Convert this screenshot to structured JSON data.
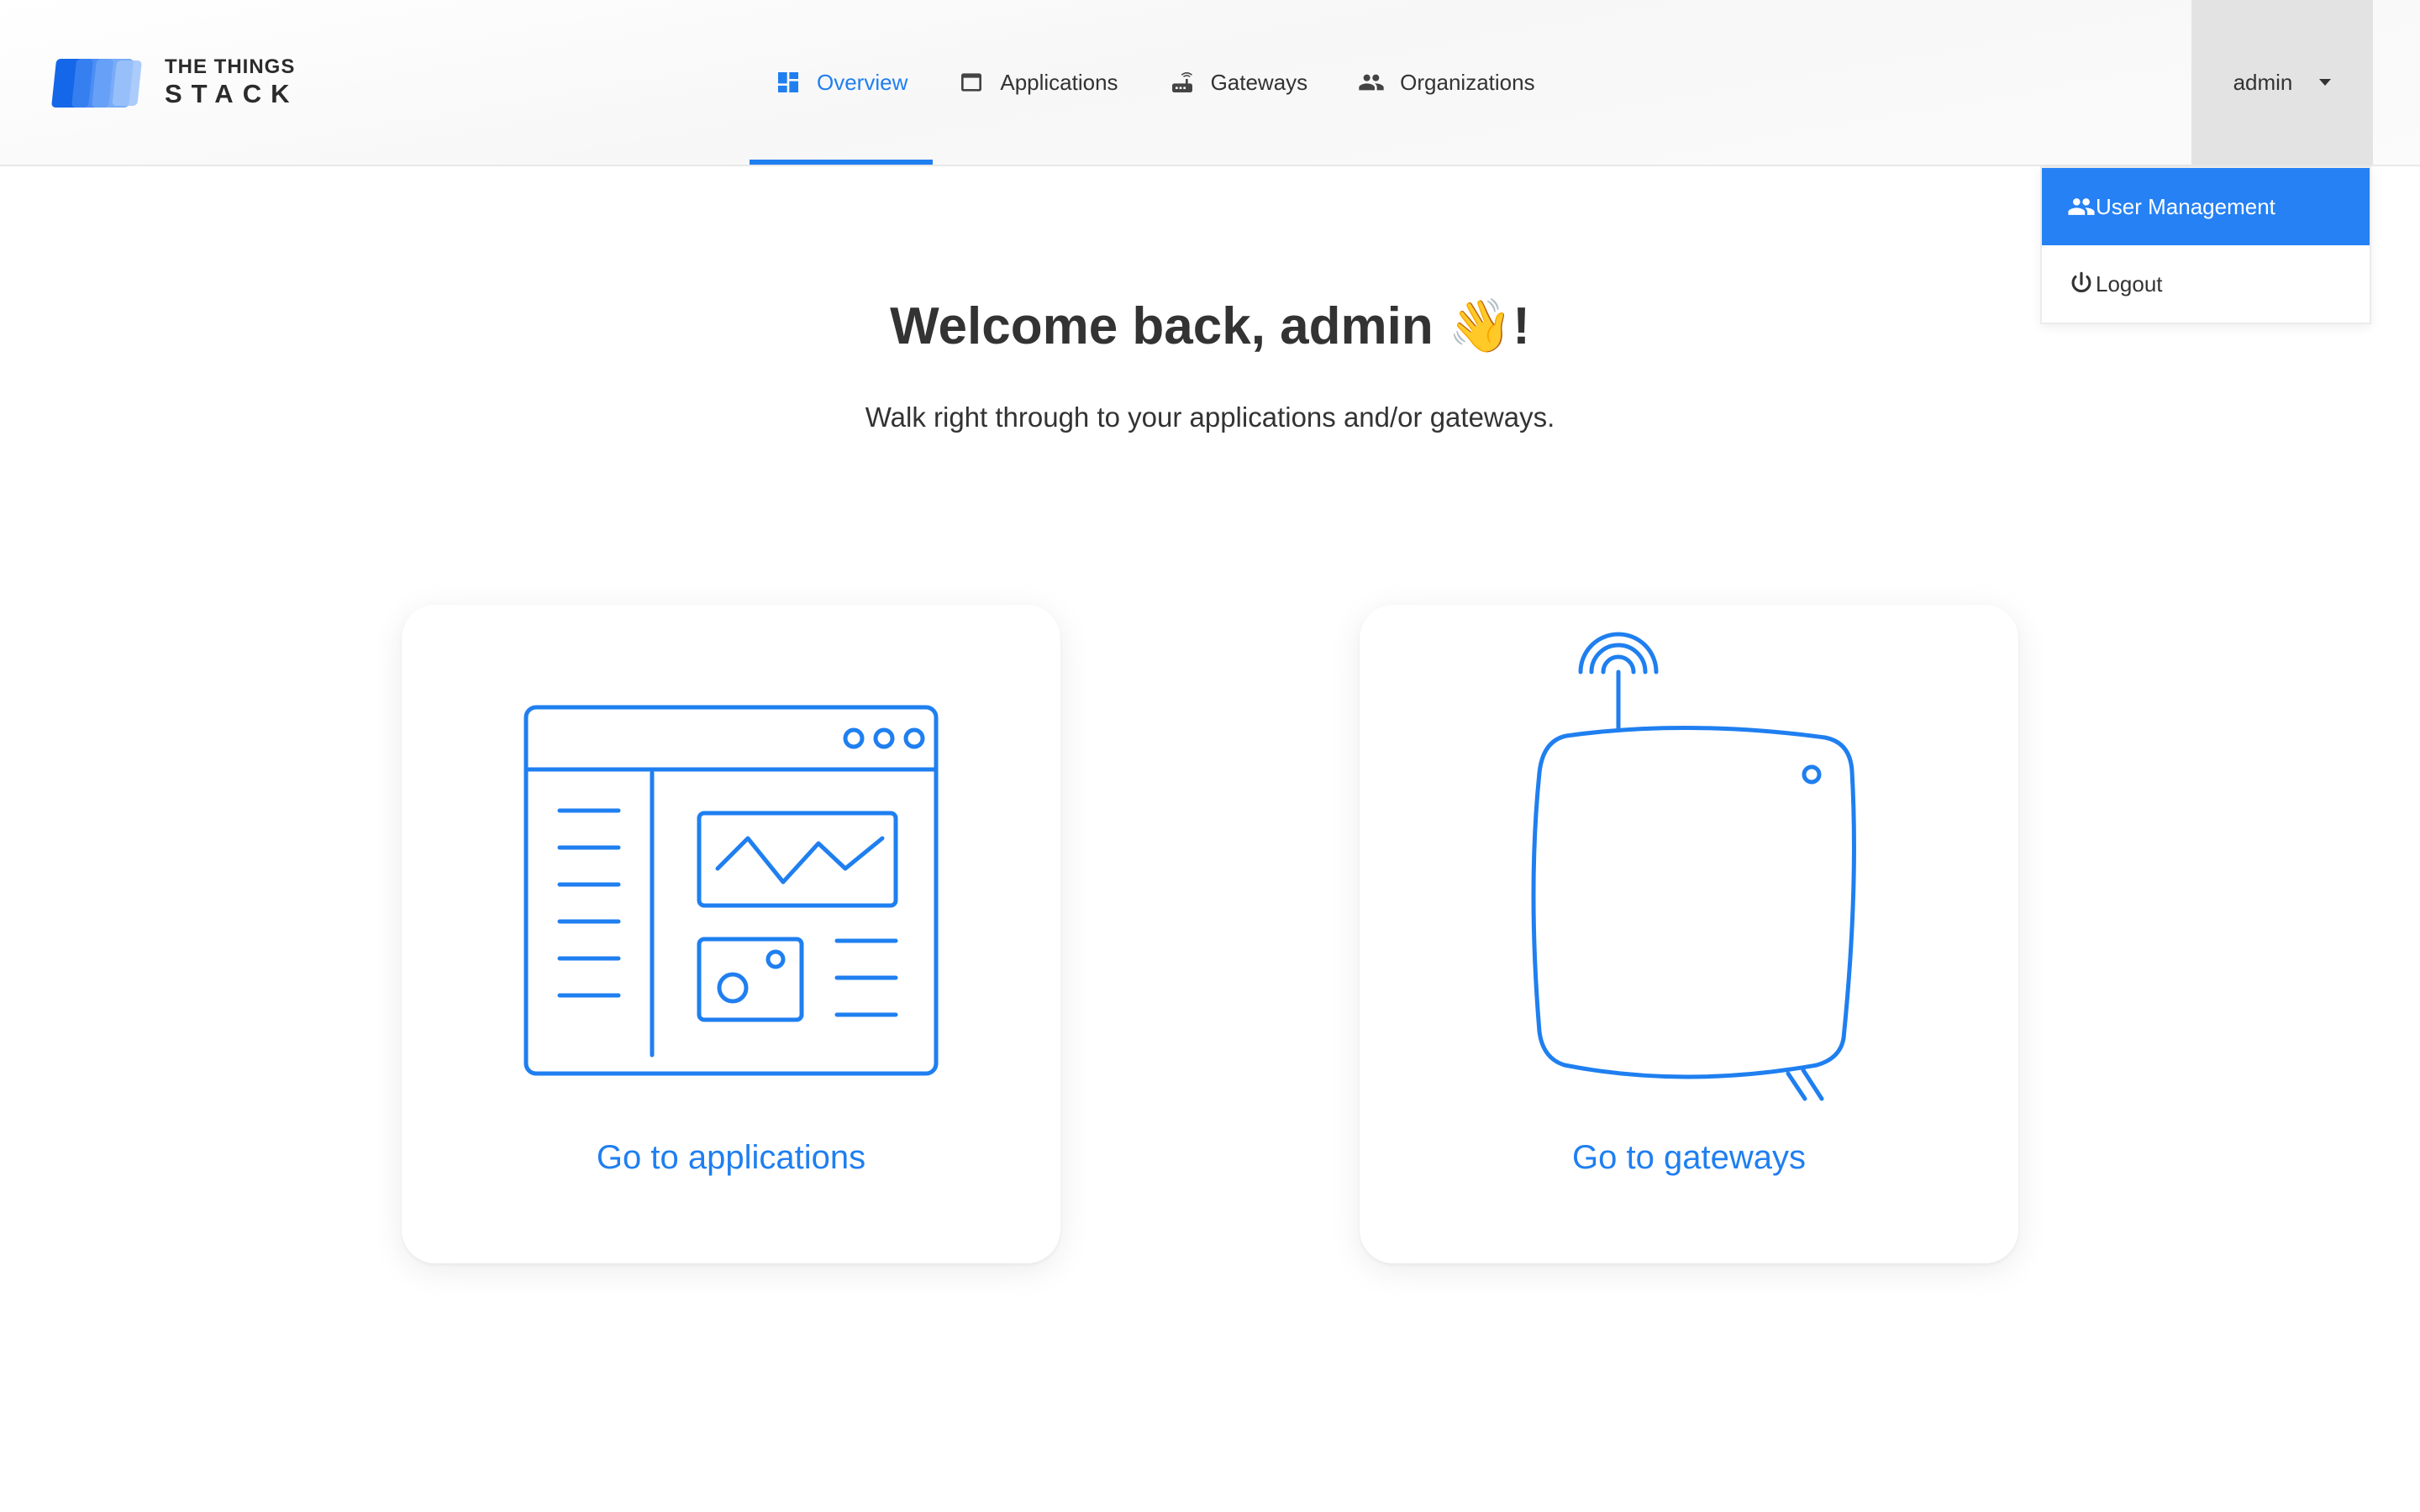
{
  "brand": {
    "line1": "THE THINGS",
    "line2": "STACK"
  },
  "nav": {
    "items": [
      {
        "label": "Overview",
        "icon": "dashboard-icon",
        "active": true
      },
      {
        "label": "Applications",
        "icon": "application-window-icon",
        "active": false
      },
      {
        "label": "Gateways",
        "icon": "router-icon",
        "active": false
      },
      {
        "label": "Organizations",
        "icon": "people-icon",
        "active": false
      }
    ]
  },
  "user": {
    "name": "admin",
    "menu": [
      {
        "label": "User Management",
        "icon": "people-icon",
        "selected": true
      },
      {
        "label": "Logout",
        "icon": "power-icon",
        "selected": false
      }
    ]
  },
  "main": {
    "welcome_text": "Welcome back, admin",
    "welcome_emoji": "👋",
    "welcome_punct": "!",
    "subtitle": "Walk right through to your applications and/or gateways."
  },
  "cards": {
    "applications": {
      "label": "Go to applications",
      "icon": "application-dashboard-icon"
    },
    "gateways": {
      "label": "Go to gateways",
      "icon": "gateway-device-icon"
    }
  },
  "colors": {
    "accent": "#1f7ff0",
    "menu_selected": "#2581f4",
    "user_button_bg": "#e3e3e3"
  }
}
